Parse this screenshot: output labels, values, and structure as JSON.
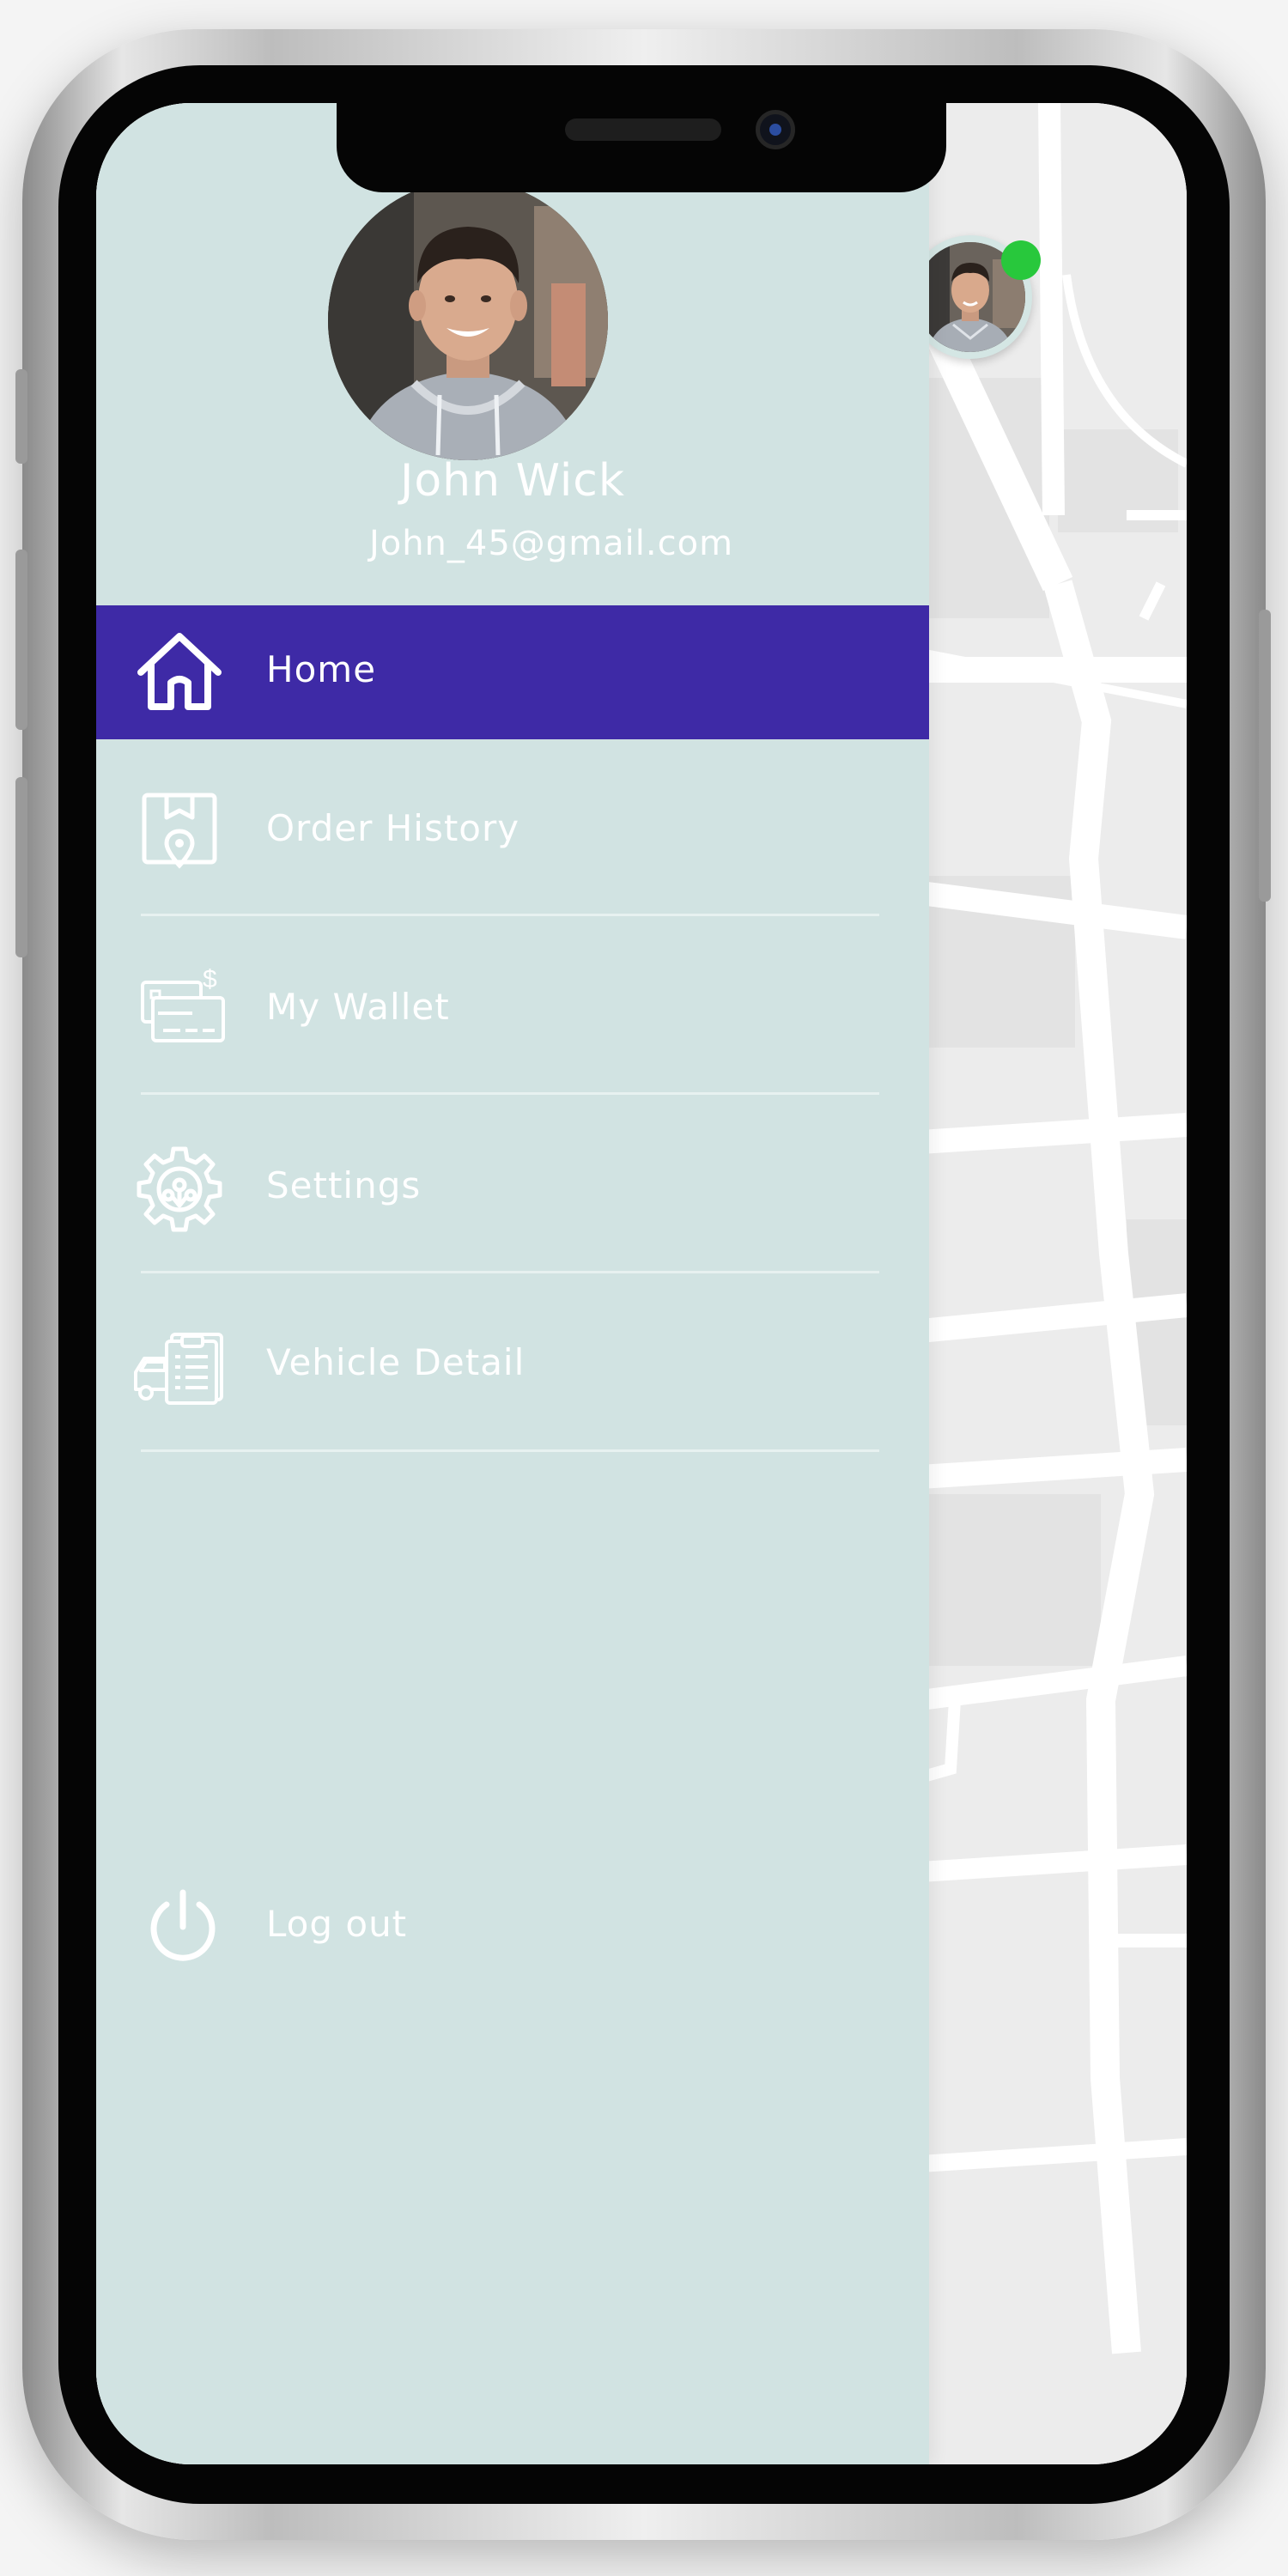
{
  "profile": {
    "name": "John Wick",
    "email": "John_45@gmail.com"
  },
  "menu": {
    "items": [
      {
        "label": "Home",
        "icon": "home-icon",
        "active": true
      },
      {
        "label": "Order History",
        "icon": "order-history-icon",
        "active": false
      },
      {
        "label": "My Wallet",
        "icon": "wallet-icon",
        "active": false
      },
      {
        "label": "Settings",
        "icon": "settings-gear-icon",
        "active": false
      },
      {
        "label": "Vehicle Detail",
        "icon": "vehicle-detail-icon",
        "active": false
      }
    ],
    "logout": {
      "label": "Log out",
      "icon": "power-icon"
    }
  },
  "status": {
    "online": true
  },
  "colors": {
    "drawer_bg": "#d1e3e2",
    "active_item_bg": "#3e2aa6",
    "online_indicator": "#28c83c",
    "text": "#ffffff",
    "map_bg": "#ececec",
    "map_roads": "#ffffff"
  }
}
